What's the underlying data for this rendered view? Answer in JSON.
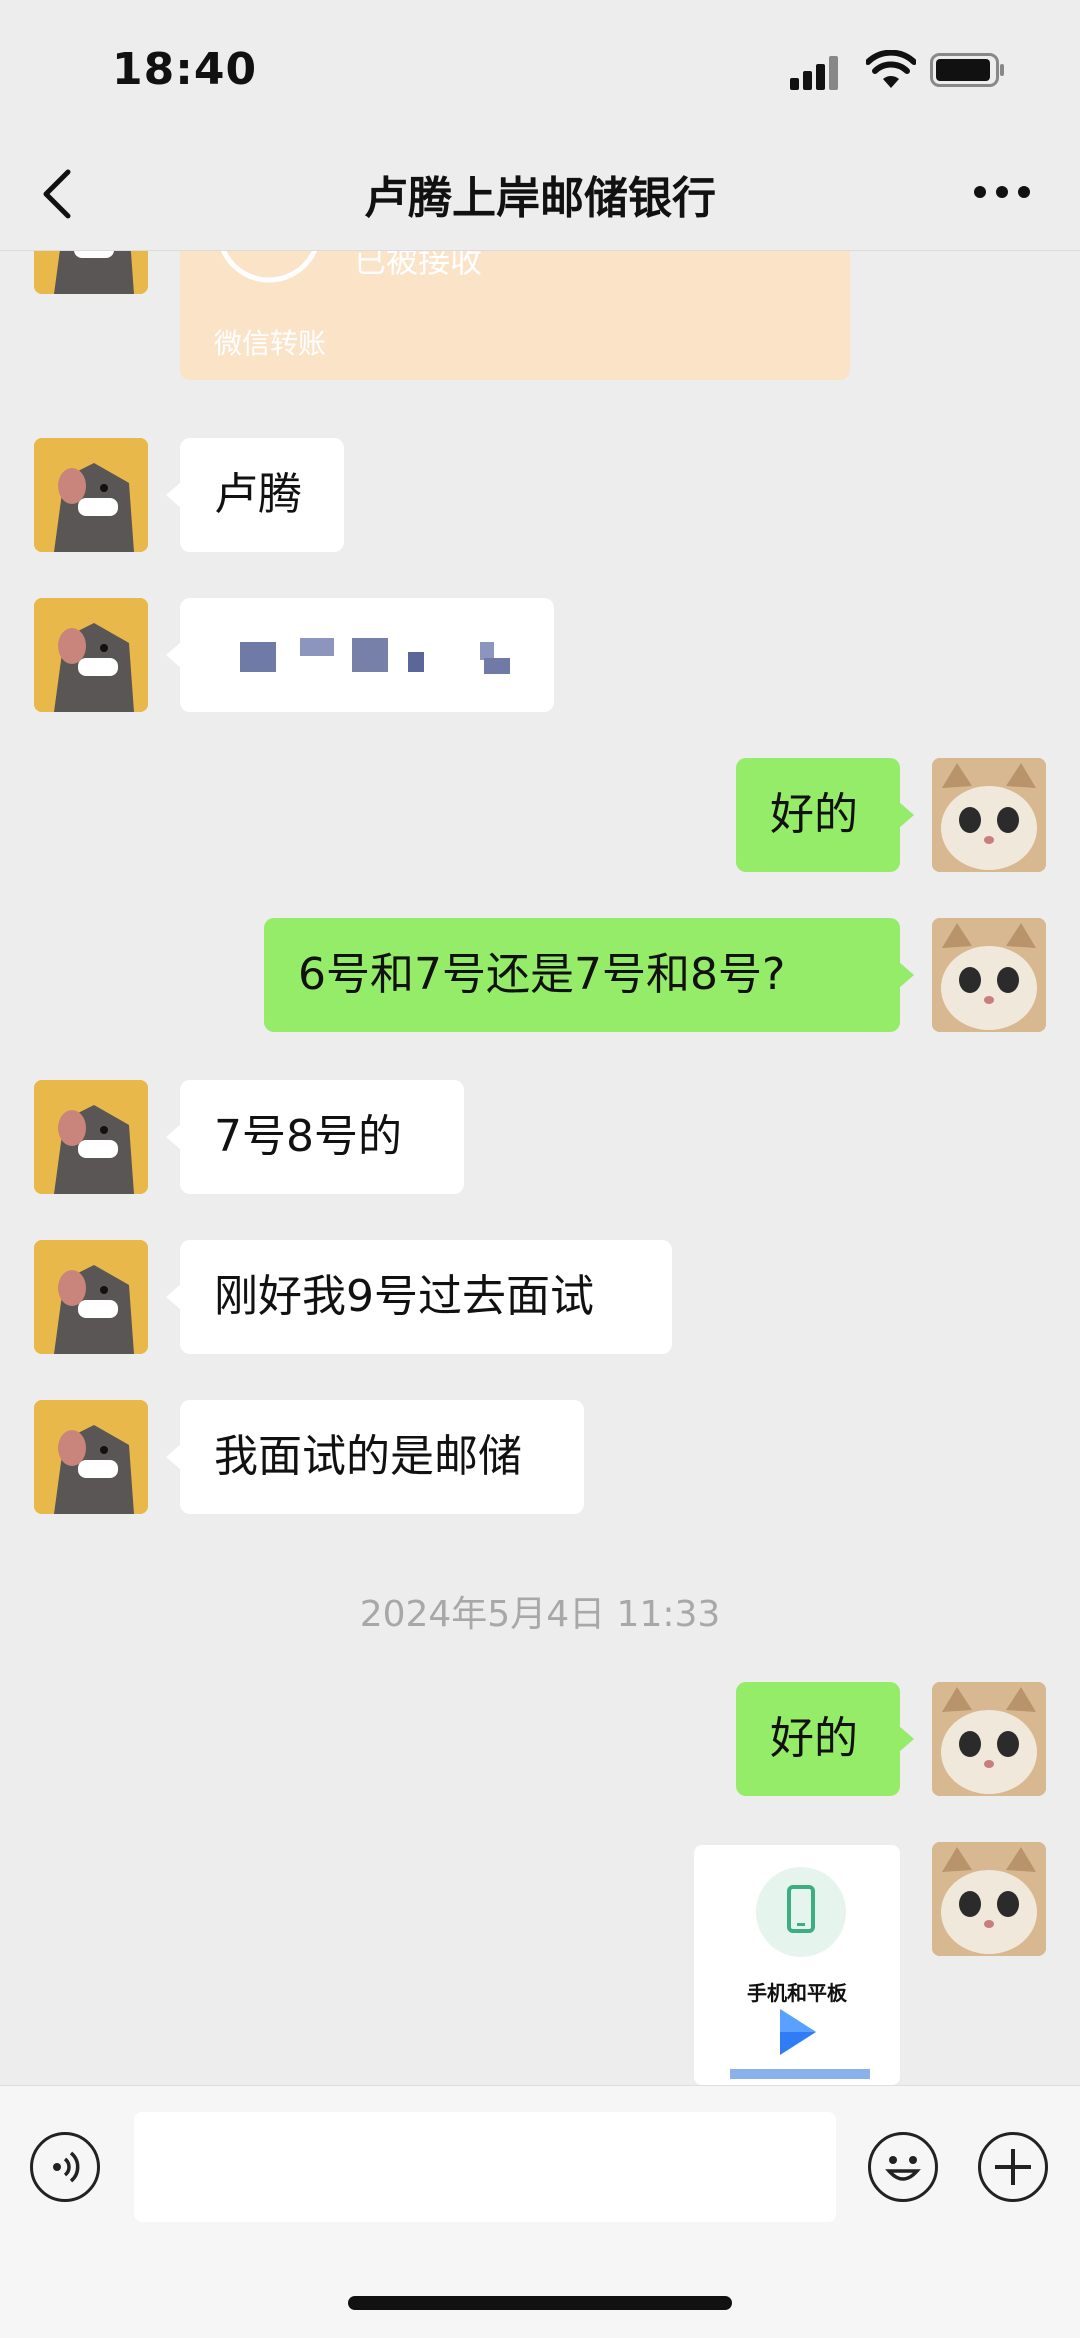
{
  "status_bar": {
    "time": "18:40"
  },
  "nav": {
    "title": "卢腾上岸邮储银行"
  },
  "transfer": {
    "status": "已被接收",
    "footer": "微信转账"
  },
  "messages": [
    {
      "side": "in",
      "text": "卢腾"
    },
    {
      "side": "in",
      "text": ""
    },
    {
      "side": "out",
      "text": "好的"
    },
    {
      "side": "out",
      "text": "6号和7号还是7号和8号?"
    },
    {
      "side": "in",
      "text": "7号8号的"
    },
    {
      "side": "in",
      "text": "刚好我9号过去面试"
    },
    {
      "side": "in",
      "text": "我面试的是邮储"
    },
    {
      "side": "out",
      "text": "好的"
    }
  ],
  "timestamp": "2024年5月4日 11:33",
  "card": {
    "label": "手机和平板"
  },
  "input": {
    "placeholder": ""
  },
  "colors": {
    "outgoing_bubble": "#95ec69",
    "incoming_bubble": "#ffffff",
    "background": "#ededed",
    "transfer_card": "#fbe3c8"
  },
  "icons": [
    "back-icon",
    "more-icon",
    "voice-icon",
    "emoji-icon",
    "plus-icon",
    "phone-icon",
    "play-icon"
  ]
}
